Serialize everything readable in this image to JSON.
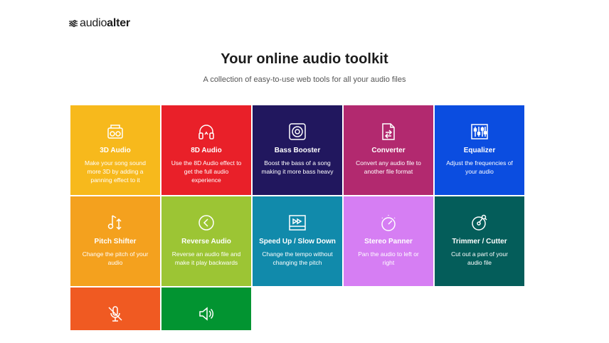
{
  "header": {
    "logo_light": "audio",
    "logo_bold": "alter"
  },
  "hero": {
    "title": "Your online audio toolkit",
    "subtitle": "A collection of easy-to-use web tools for all your audio files"
  },
  "tools": [
    {
      "name": "3D Audio",
      "desc": "Make your song sound more 3D by adding a panning effect to it",
      "color": "#f7b91c",
      "icon": "boombox-icon"
    },
    {
      "name": "8D Audio",
      "desc": "Use the 8D Audio effect to get the full audio experience",
      "color": "#e92029",
      "icon": "headphones-icon"
    },
    {
      "name": "Bass Booster",
      "desc": "Boost the bass of a song making it more bass heavy",
      "color": "#21175e",
      "icon": "speaker-icon"
    },
    {
      "name": "Converter",
      "desc": "Convert any audio file to another file format",
      "color": "#b2296f",
      "icon": "file-convert-icon"
    },
    {
      "name": "Equalizer",
      "desc": "Adjust the frequencies of your audio",
      "color": "#0b4de0",
      "icon": "equalizer-icon"
    },
    {
      "name": "Pitch Shifter",
      "desc": "Change the pitch of your audio",
      "color": "#f4a11e",
      "icon": "pitch-icon"
    },
    {
      "name": "Reverse Audio",
      "desc": "Reverse an audio file and make it play backwards",
      "color": "#9cc534",
      "icon": "reverse-icon"
    },
    {
      "name": "Speed Up / Slow Down",
      "desc": "Change the tempo without changing the pitch",
      "color": "#118aab",
      "icon": "fast-forward-icon"
    },
    {
      "name": "Stereo Panner",
      "desc": "Pan the audio to left or right",
      "color": "#d67ef3",
      "icon": "knob-icon"
    },
    {
      "name": "Trimmer / Cutter",
      "desc": "Cut out a part of your audio file",
      "color": "#045d5a",
      "icon": "record-cut-icon"
    },
    {
      "name": "",
      "desc": "",
      "color": "#f05a22",
      "icon": "mic-off-icon"
    },
    {
      "name": "",
      "desc": "",
      "color": "#029431",
      "icon": "volume-icon"
    }
  ]
}
